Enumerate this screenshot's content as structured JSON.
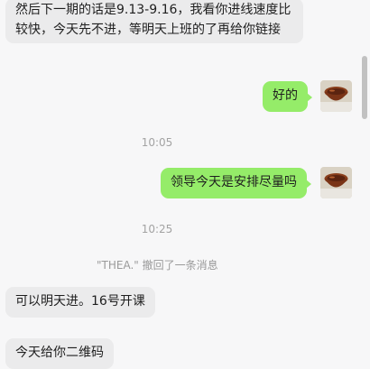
{
  "messages": [
    {
      "text": "然后下一期的话是9.13-9.16，我看你进线速度比较快，今天先不进，等明天上班的了再给你链接"
    },
    {
      "text": "好的"
    },
    {
      "time": "10:05"
    },
    {
      "text": "领导今天是安排尽量吗"
    },
    {
      "time": "10:25"
    },
    {
      "system": "\"THEA.\" 撤回了一条消息"
    },
    {
      "text": "可以明天进。16号开课"
    },
    {
      "text": "今天给你二维码"
    }
  ],
  "colors": {
    "incoming": "#ebebec",
    "outgoing": "#95ec69",
    "background": "#f7f7f8"
  },
  "icons": {
    "avatar": "bowl-photo-avatar"
  }
}
